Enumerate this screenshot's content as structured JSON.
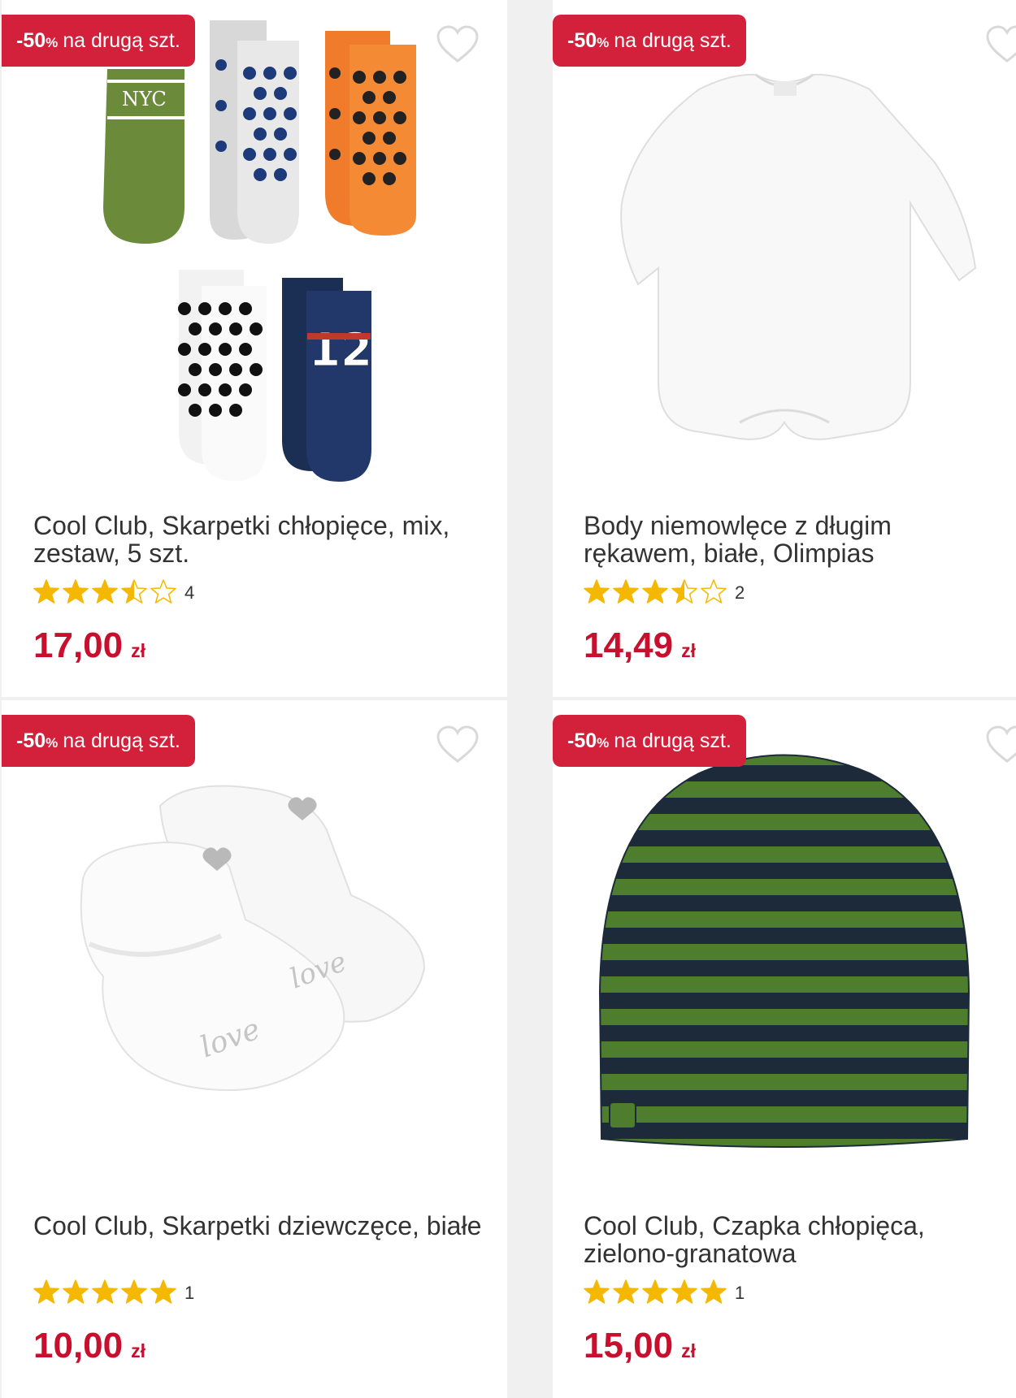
{
  "products": [
    {
      "badge_pct": "-50",
      "badge_pct_sign": "%",
      "badge_text": "na drugą szt.",
      "title": "Cool Club, Skarpetki chłopięce, mix, zestaw, 5 szt.",
      "rating": 3.5,
      "rating_count": "4",
      "price": "17,00",
      "currency": "zł",
      "image_icon": "socks-set-image"
    },
    {
      "badge_pct": "-50",
      "badge_pct_sign": "%",
      "badge_text": "na drugą szt.",
      "title": "Body niemowlęce z długim rękawem, białe, Olimpias",
      "rating": 3.5,
      "rating_count": "2",
      "price": "14,49",
      "currency": "zł",
      "image_icon": "baby-bodysuit-image"
    },
    {
      "badge_pct": "-50",
      "badge_pct_sign": "%",
      "badge_text": "na drugą szt.",
      "title": "Cool Club, Skarpetki dziewczęce, białe",
      "rating": 5,
      "rating_count": "1",
      "price": "10,00",
      "currency": "zł",
      "image_icon": "baby-booties-image"
    },
    {
      "badge_pct": "-50",
      "badge_pct_sign": "%",
      "badge_text": "na drugą szt.",
      "title": "Cool Club, Czapka chłopięca, zielono-granatowa",
      "rating": 5,
      "rating_count": "1",
      "price": "15,00",
      "currency": "zł",
      "image_icon": "striped-beanie-image"
    }
  ],
  "colors": {
    "badge_bg": "#d4213b",
    "price": "#c8102e",
    "star": "#f5b800",
    "background": "#f0f0f0"
  }
}
